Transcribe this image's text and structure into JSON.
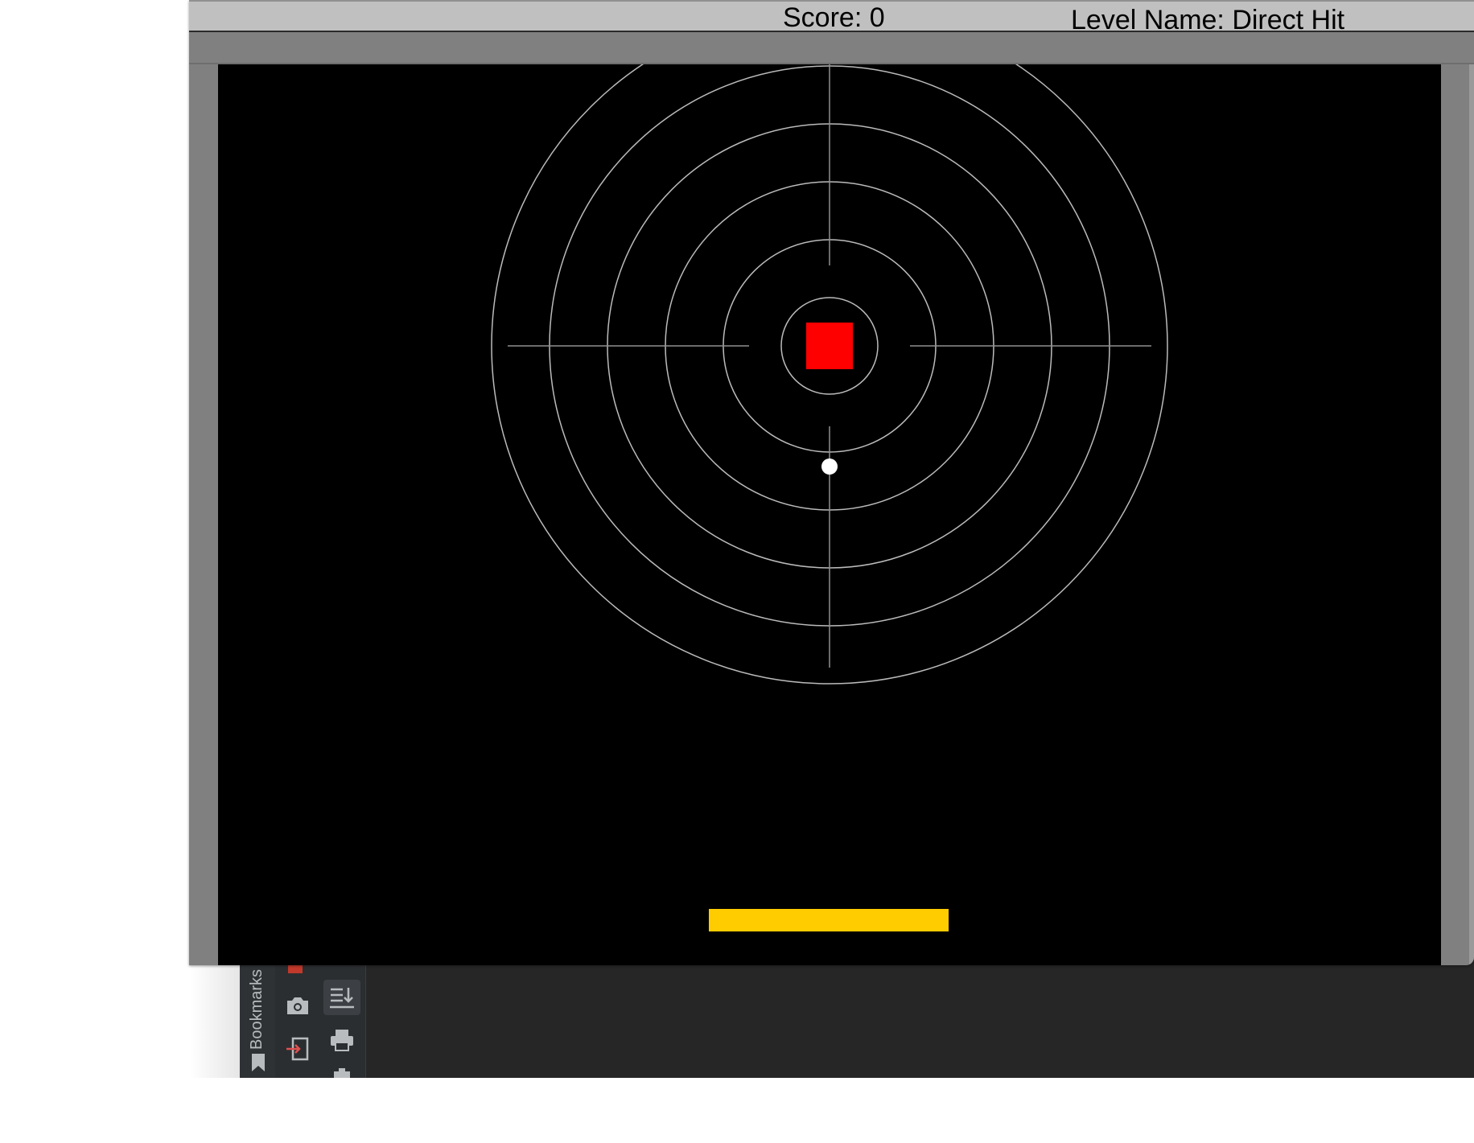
{
  "hud": {
    "score_text": "Score: 0",
    "level_text": "Level Name: Direct Hit"
  },
  "ide": {
    "sidebar_tab_label": "Bookmarks",
    "icons": [
      "camera-icon",
      "import-icon",
      "download-list-icon",
      "print-icon",
      "bookmark-icon"
    ]
  },
  "game": {
    "level_name": "Direct Hit",
    "score": 0,
    "colors": {
      "background": "#000000",
      "wall": "#808080",
      "hud": "#c0c0c0",
      "target_block": "#ff0000",
      "paddle": "#ffcc00",
      "ball": "#ffffff",
      "reticle": "#bbbbbb"
    },
    "reticle_rings": 6,
    "blocks_remaining": 1
  }
}
